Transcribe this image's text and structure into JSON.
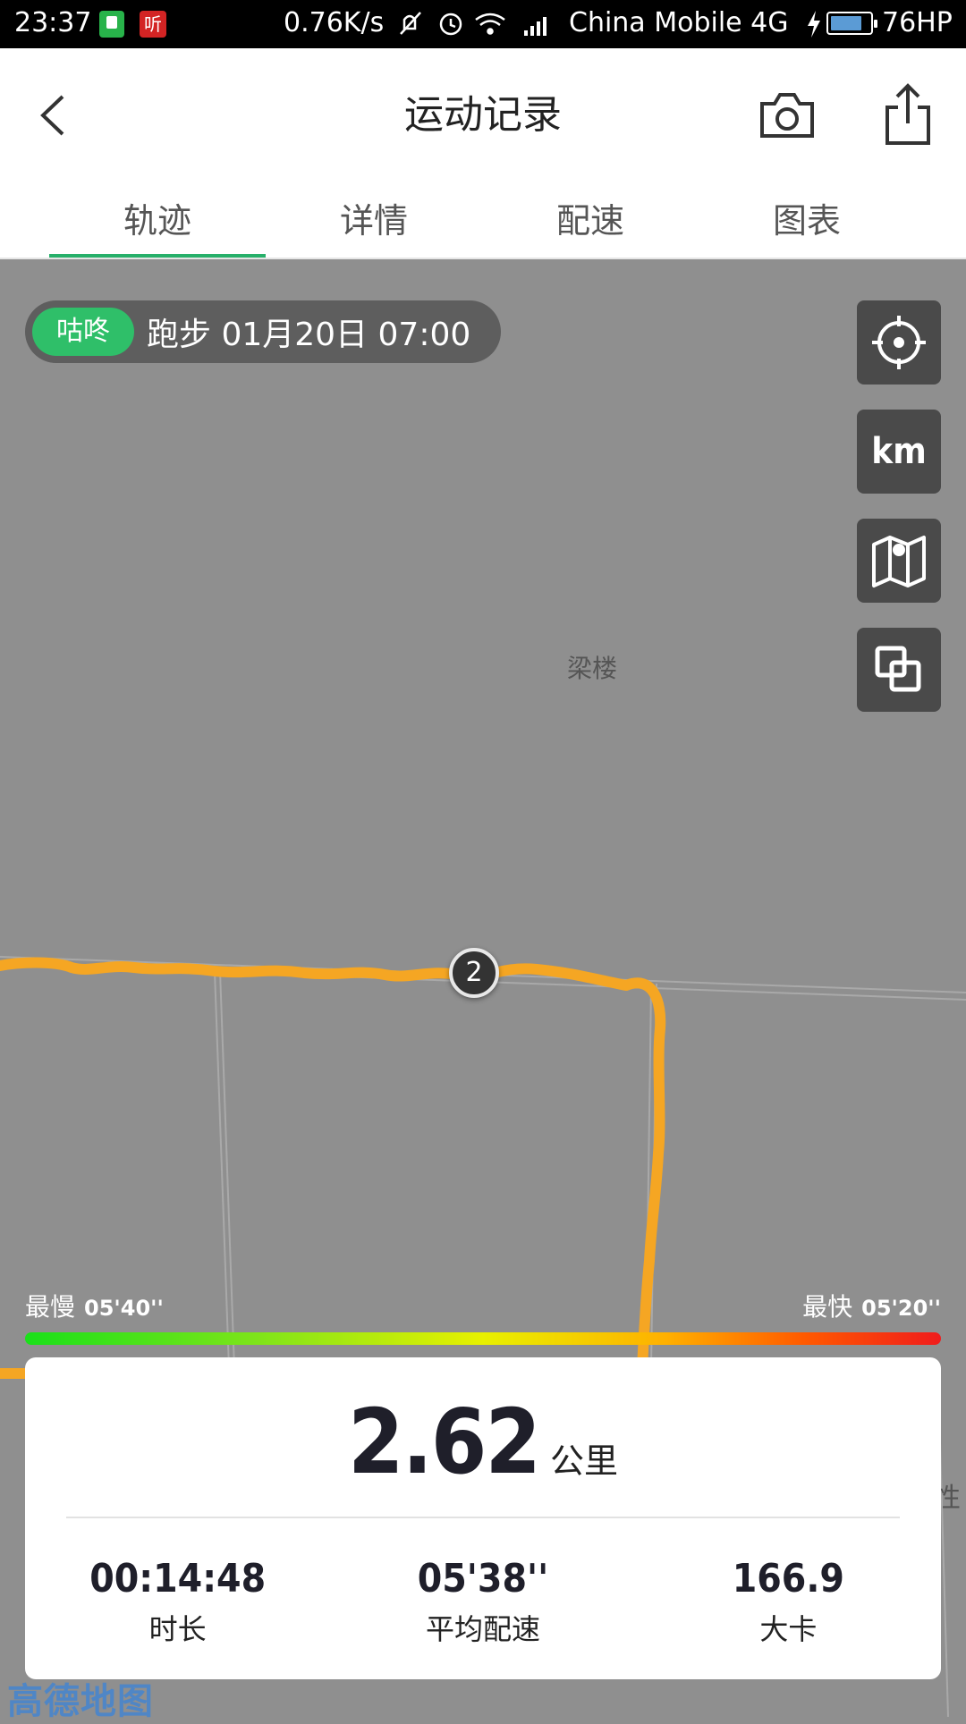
{
  "status_bar": {
    "time": "23:37",
    "app_icon_2": "听",
    "net_speed": "0.76K/s",
    "carrier": "China Mobile 4G",
    "battery_label": "76HP"
  },
  "header": {
    "title": "运动记录"
  },
  "tabs": [
    "轨迹",
    "详情",
    "配速",
    "图表"
  ],
  "record": {
    "app": "咕咚",
    "summary": "跑步  01月20日 07:00"
  },
  "map": {
    "unit_button": "km",
    "place_label": "梁楼",
    "km_marker": "2",
    "edge_label": "性",
    "provider": "高德地图",
    "route_color": "#f5a623"
  },
  "pace_legend": {
    "slow_label": "最慢",
    "slow_value": "05'40''",
    "fast_label": "最快",
    "fast_value": "05'20''"
  },
  "summary_card": {
    "distance": "2.62",
    "distance_unit": "公里",
    "stats": [
      {
        "value": "00:14:48",
        "label": "时长"
      },
      {
        "value": "05'38''",
        "label": "平均配速"
      },
      {
        "value": "166.9",
        "label": "大卡"
      }
    ]
  },
  "colors": {
    "accent": "#27b06a",
    "badge": "#2fbf69",
    "map_bg": "#8f8f8f"
  }
}
